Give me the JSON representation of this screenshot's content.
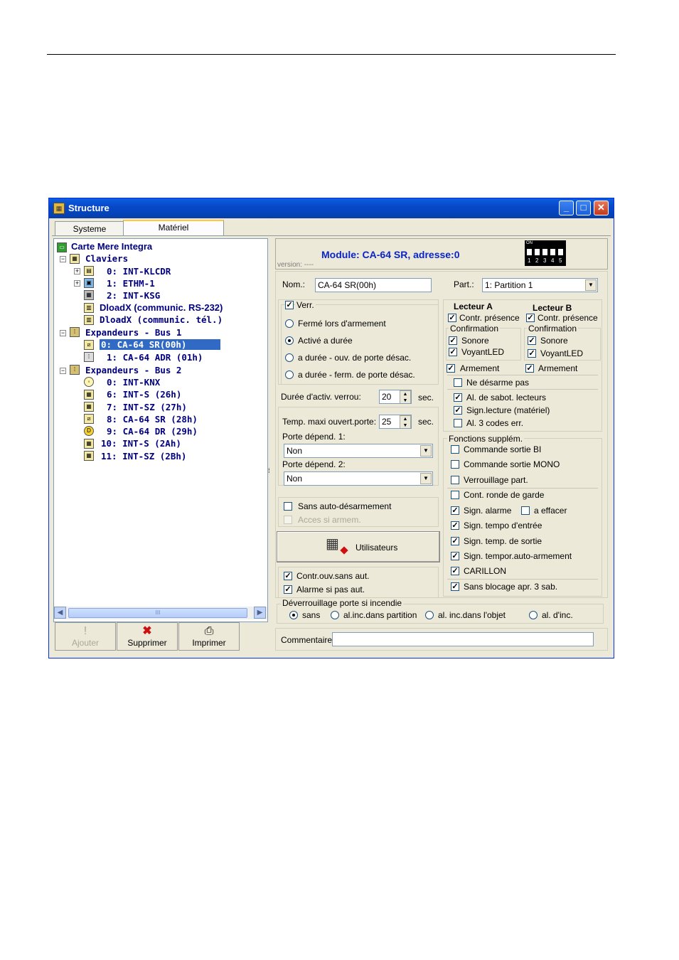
{
  "window": {
    "title": "Structure"
  },
  "tabs": [
    "Systeme",
    "Matériel"
  ],
  "tree": {
    "root": "Carte Mere Integra",
    "claviers": "Claviers",
    "kb0": "0: INT-KLCDR",
    "kb1": "1: ETHM-1",
    "kb2": "2: INT-KSG",
    "dload232": "DloadX (communic. RS-232)",
    "dloadtel": "DloadX (communic. tél.)",
    "bus1": "Expandeurs - Bus 1",
    "b1_0": "0: CA-64 SR(00h)",
    "b1_1": "1: CA-64 ADR (01h)",
    "bus2": "Expandeurs - Bus 2",
    "b2_0": "0: INT-KNX",
    "b2_6": "6: INT-S (26h)",
    "b2_7": "7: INT-SZ (27h)",
    "b2_8": "8: CA-64 SR (28h)",
    "b2_9": "9: CA-64 DR (29h)",
    "b2_10": "10: INT-S (2Ah)",
    "b2_11": "11: INT-SZ (2Bh)"
  },
  "scroll": {
    "thumb_grip": "III"
  },
  "buttons": {
    "ajouter": "Ajouter",
    "supprimer": "Supprimer",
    "imprimer": "Imprimer"
  },
  "module": {
    "title": "Module: CA-64 SR, adresse:0",
    "version": "version: ----",
    "dip_label": "ON",
    "dip_numbers": [
      "1",
      "2",
      "3",
      "4",
      "5"
    ]
  },
  "form": {
    "nom_label": "Nom.:",
    "nom_value": "CA-64 SR(00h)",
    "part_label": "Part.:",
    "part_value": "1: Partition  1",
    "verr": "Verr.",
    "ferme": "Fermé lors d'armement",
    "active": "Activé a durée",
    "duree_ouv": "a durée - ouv. de porte désac.",
    "duree_ferm": "a durée - ferm. de porte désac.",
    "duree_label": "Durée d'activ. verrou:",
    "duree_value": "20",
    "sec": "sec.",
    "temp_label": "Temp. maxi ouvert.porte:",
    "temp_value": "25",
    "dep1_label": "Porte dépend. 1:",
    "dep1_value": "Non",
    "dep2_label": "Porte dépend. 2:",
    "dep2_value": "Non",
    "sans_auto": "Sans auto-désarmement",
    "acces": "Acces si armem.",
    "utilisateurs": "Utilisateurs",
    "contr_ouv": "Contr.ouv.sans aut.",
    "alarme_pas": "Alarme si pas aut."
  },
  "lecteurs": {
    "a_title": "Lecteur A",
    "b_title": "Lecteur B",
    "contr": "Contr. présence",
    "confirmation": "Confirmation",
    "sonore": "Sonore",
    "voyant": "VoyantLED",
    "armement": "Armement",
    "ne_desarme": "Ne désarme pas",
    "sabot": "Al. de sabot. lecteurs",
    "sign_lecture": "Sign.lecture (matériel)",
    "trois_codes": "Al. 3 codes err."
  },
  "fonctions": {
    "title": "Fonctions supplém.",
    "cmd_bi": "Commande sortie BI",
    "cmd_mono": "Commande sortie MONO",
    "verr_part": "Verrouillage part.",
    "ronde": "Cont. ronde de garde",
    "sign_alarme": "Sign. alarme",
    "a_effacer": "a effacer",
    "tempo_entree": "Sign. tempo d'entrée",
    "temp_sortie": "Sign. temp. de sortie",
    "tempor_auto": "Sign. tempor.auto-armement",
    "carillon": "CARILLON",
    "sans_blocage": "Sans blocage apr. 3 sab."
  },
  "incendie": {
    "title": "Déverrouillage porte si incendie",
    "sans": "sans",
    "partition": "al.inc.dans partition",
    "objet": "al. inc.dans l'objet",
    "dinc": "al. d'inc."
  },
  "commentaire": {
    "label": "Commentaire:",
    "value": ""
  }
}
